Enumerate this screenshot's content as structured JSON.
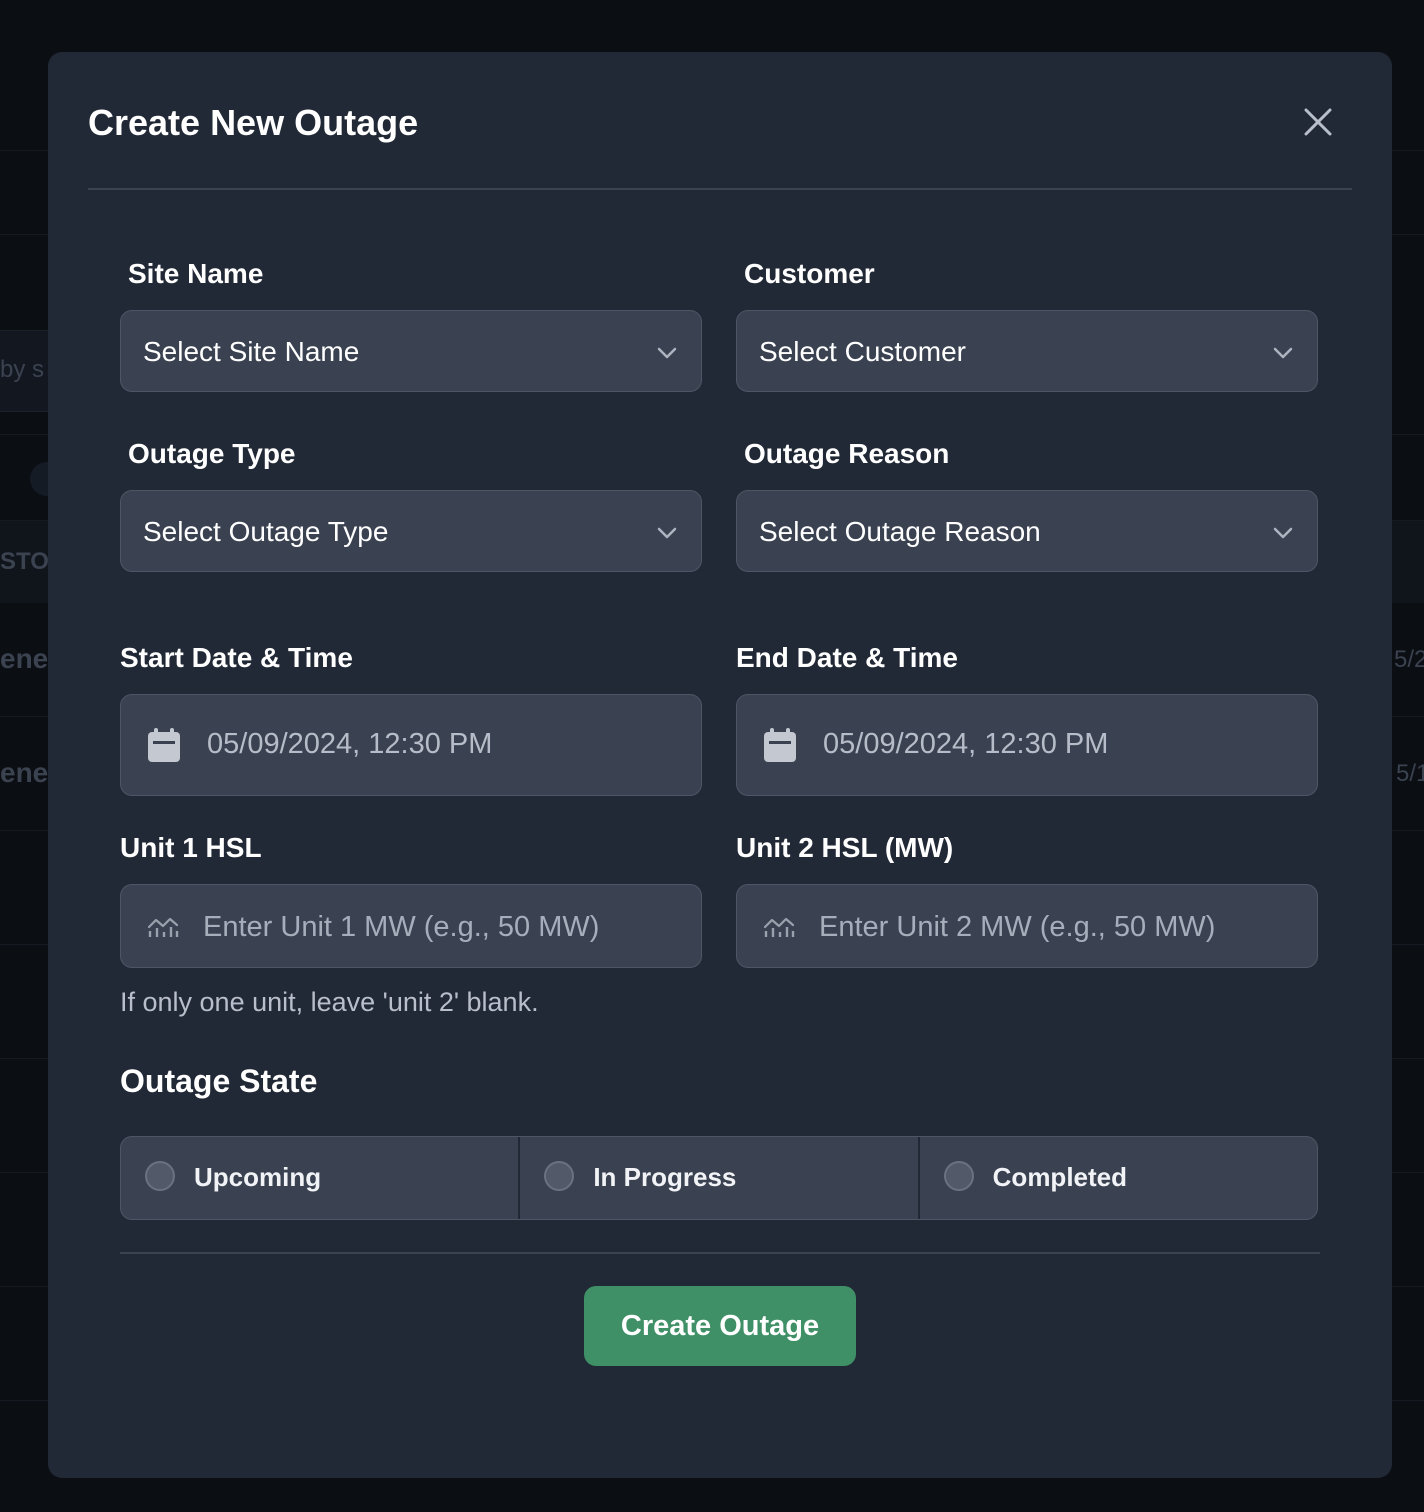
{
  "background": {
    "fragments": [
      "by s",
      "STO",
      "ene",
      "ene",
      "5/2",
      "5/1"
    ]
  },
  "modal": {
    "title": "Create New Outage",
    "close_icon": "close-icon"
  },
  "form": {
    "site_name": {
      "label": "Site Name",
      "value": "Select Site Name"
    },
    "customer": {
      "label": "Customer",
      "value": "Select Customer"
    },
    "outage_type": {
      "label": "Outage Type",
      "value": "Select Outage Type"
    },
    "outage_reason": {
      "label": "Outage Reason",
      "value": "Select Outage Reason"
    },
    "start": {
      "label": "Start Date & Time",
      "value": "05/09/2024, 12:30 PM",
      "icon": "calendar-icon"
    },
    "end": {
      "label": "End Date & Time",
      "value": "05/09/2024, 12:30 PM",
      "icon": "calendar-icon"
    },
    "unit1": {
      "label": "Unit 1 HSL",
      "placeholder": "Enter Unit 1 MW (e.g., 50 MW)",
      "icon": "chart-icon"
    },
    "unit2": {
      "label": "Unit 2 HSL (MW)",
      "placeholder": "Enter Unit 2 MW (e.g., 50 MW)",
      "icon": "chart-icon"
    },
    "helper": "If only one unit, leave 'unit 2' blank."
  },
  "outage_state": {
    "title": "Outage State",
    "options": [
      "Upcoming",
      "In Progress",
      "Completed"
    ]
  },
  "submit_label": "Create Outage",
  "colors": {
    "modal_bg": "#222936",
    "input_bg": "#3a4252",
    "primary": "#3f9066"
  }
}
